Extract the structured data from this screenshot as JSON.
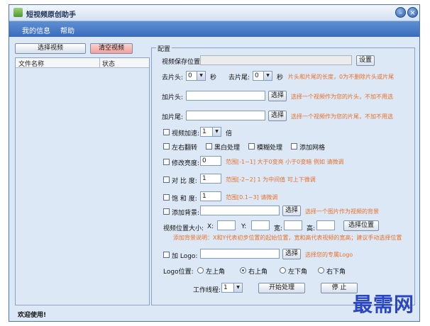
{
  "window": {
    "title": "短视频原创助手",
    "minimize_glyph": "–",
    "close_glyph": "×"
  },
  "menu": {
    "items": [
      "我的信息",
      "帮助"
    ]
  },
  "left": {
    "select_button": "选择视频",
    "clear_button": "清空视频",
    "columns": [
      "文件名称",
      "状态"
    ]
  },
  "status_text": "欢迎使用!",
  "config": {
    "legend": "配置",
    "save_location": {
      "label": "视频保存位置:",
      "value": "",
      "button": "设置"
    },
    "trim": {
      "head_label": "去片头:",
      "head_value": "0",
      "head_unit": "秒",
      "tail_label": "去片尾:",
      "tail_value": "0",
      "tail_unit": "秒",
      "hint": "片头和片尾的长度，0为不删除片头或片尾"
    },
    "add_head": {
      "label": "加片头:",
      "button": "选择",
      "hint": "选择一个视频作为您的片头，不加不用选"
    },
    "add_tail": {
      "label": "加片尾:",
      "button": "选择",
      "hint": "选择一个视频作为您的片尾，不加不用选"
    },
    "speed": {
      "label": "视频加速:",
      "value": "1",
      "unit": "倍"
    },
    "effects": [
      "左右翻转",
      "黑白处理",
      "模糊处理",
      "添加网格"
    ],
    "brightness": {
      "label": "修改亮度:",
      "value": "0",
      "hint": "范围[-1~1]  大于0变亮 小于0变暗  例如 请微调"
    },
    "contrast": {
      "label": "对 比 度:",
      "value": "1",
      "hint": "范围[-2~2]  1 为中间值  可上下微调"
    },
    "saturation": {
      "label": "饱 和 度:",
      "value": "1",
      "hint": "范围[0.1~3]  请微调"
    },
    "background": {
      "label": "添加背景:",
      "button": "选择",
      "hint": "选择一个图片作为视频的背景"
    },
    "position": {
      "label": "视频位置大小:",
      "x_label": "X:",
      "y_label": "Y:",
      "w_label": "宽:",
      "h_label": "高:",
      "button": "选择位置",
      "hint": "添加背景说明：X和Y代表初步位置的起始位置，宽和高代表视频的宽高；建议手动选择位置"
    },
    "logo": {
      "label": "加 Logo:",
      "button": "选择",
      "hint": "选择您的专属Logo"
    },
    "logo_position": {
      "label": "Logo位置:",
      "options": [
        "左上角",
        "右上角",
        "左下角",
        "右下角"
      ],
      "selected": 1
    },
    "threads": {
      "label": "工作线程:",
      "value": "1"
    },
    "start_button": "开始处理",
    "stop_button": "停 止"
  },
  "watermark": "最需网",
  "colors": {
    "menubar": "#4a7cc6",
    "hint": "#e8702a",
    "clear_button": "#f7b7b5"
  }
}
